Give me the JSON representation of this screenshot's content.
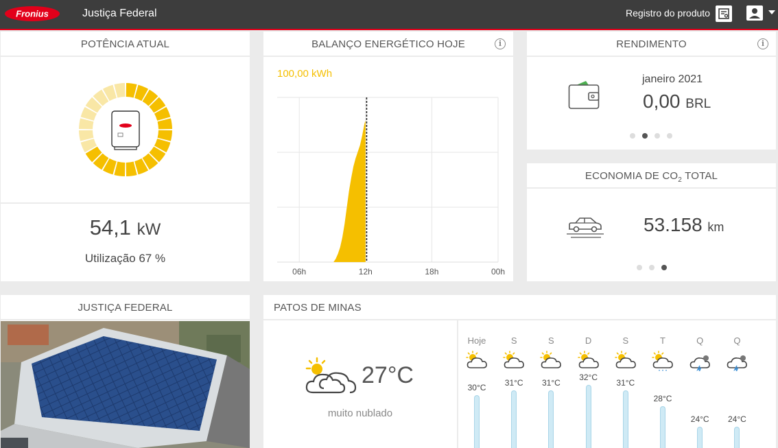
{
  "header": {
    "logo_text": "Fronius",
    "site_name": "Justiça Federal",
    "product_registration": "Registro do produto"
  },
  "colors": {
    "accent": "#f5bf00",
    "brand_red": "#e2001a",
    "topbar": "#3d3d3d"
  },
  "power": {
    "title": "POTÊNCIA ATUAL",
    "value": "54,1",
    "unit": "kW",
    "utilization": "Utilização 67 %",
    "utilization_fraction": 0.67
  },
  "balance": {
    "title": "BALANÇO ENERGÉTICO HOJE",
    "ymax_label": "100,00 kWh"
  },
  "chart_data": {
    "type": "area",
    "title": "BALANÇO ENERGÉTICO HOJE",
    "xlabel": "",
    "ylabel": "100,00 kWh",
    "x_ticks": [
      "06h",
      "12h",
      "18h",
      "00h"
    ],
    "xlim": [
      4,
      24
    ],
    "ylim": [
      0,
      100
    ],
    "current_time": 12.1,
    "series": [
      {
        "x": [
          9.1,
          9.3,
          9.5,
          9.7,
          9.9,
          10.1,
          10.3,
          10.5,
          10.7,
          10.9,
          11.1,
          11.3,
          11.5,
          11.7,
          11.9,
          12.0
        ],
        "values": [
          0,
          2,
          5,
          9,
          15,
          23,
          33,
          43,
          51,
          58,
          63,
          67,
          71,
          77,
          84,
          86
        ]
      }
    ]
  },
  "yield": {
    "title": "RENDIMENTO",
    "period": "janeiro 2021",
    "value": "0,00",
    "unit": "BRL",
    "dots": [
      false,
      true,
      false,
      false
    ]
  },
  "co2": {
    "title_pre": "ECONOMIA DE CO",
    "title_sub": "2",
    "title_post": " TOTAL",
    "value": "53.158",
    "unit": "km",
    "dots": [
      false,
      false,
      true
    ]
  },
  "photo": {
    "title": "JUSTIÇA FEDERAL"
  },
  "weather": {
    "title": "PATOS DE MINAS",
    "current_temp": "27°C",
    "current_desc": "muito nublado",
    "forecast": [
      {
        "day": "Hoje",
        "temp": "30°C",
        "temp_value": 30,
        "icon": "sun-cloud-icon"
      },
      {
        "day": "S",
        "temp": "31°C",
        "temp_value": 31,
        "icon": "sun-cloud-icon"
      },
      {
        "day": "S",
        "temp": "31°C",
        "temp_value": 31,
        "icon": "sun-cloud-icon"
      },
      {
        "day": "D",
        "temp": "32°C",
        "temp_value": 32,
        "icon": "sun-cloud-icon"
      },
      {
        "day": "S",
        "temp": "31°C",
        "temp_value": 31,
        "icon": "sun-cloud-icon"
      },
      {
        "day": "T",
        "temp": "28°C",
        "temp_value": 28,
        "icon": "sun-cloud-rain-icon"
      },
      {
        "day": "Q",
        "temp": "24°C",
        "temp_value": 24,
        "icon": "thunder-cloud-icon"
      },
      {
        "day": "Q",
        "temp": "24°C",
        "temp_value": 24,
        "icon": "thunder-cloud-icon"
      }
    ]
  }
}
